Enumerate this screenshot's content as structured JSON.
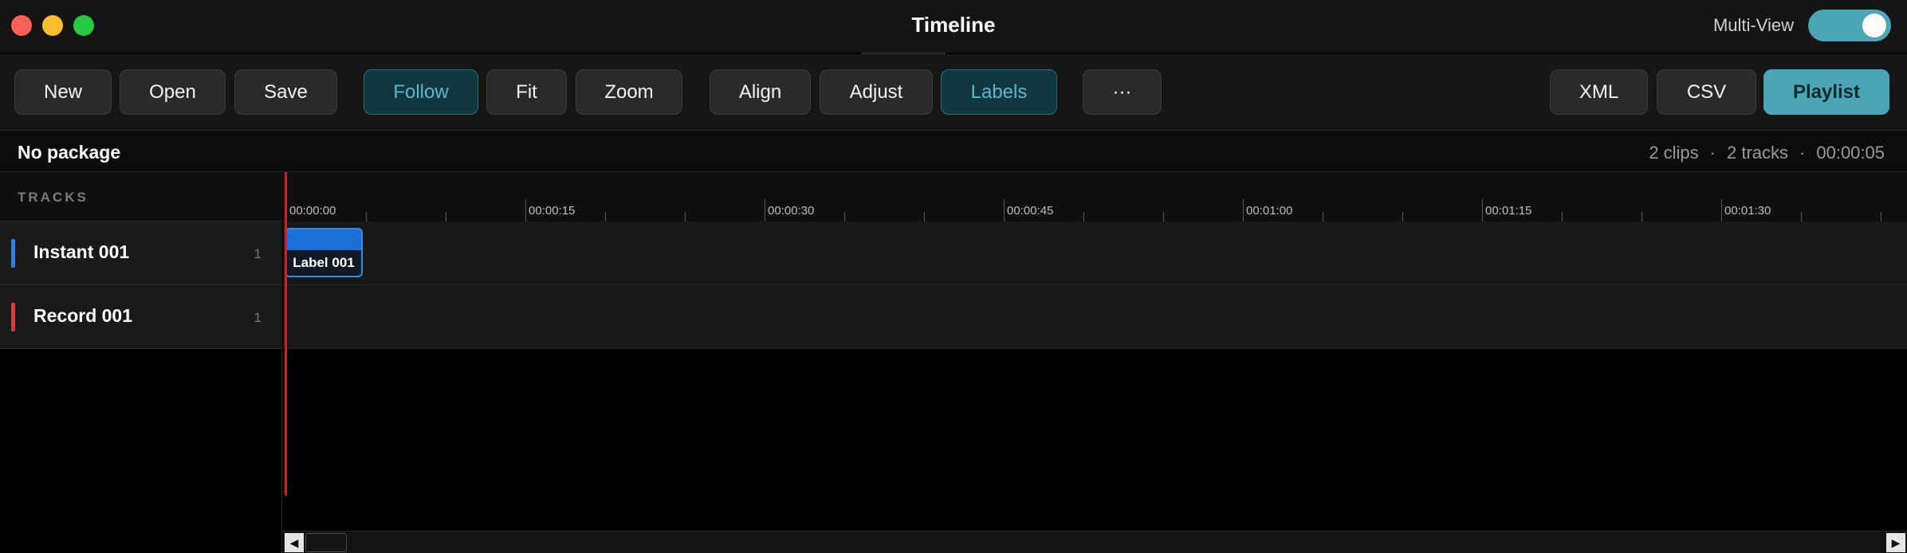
{
  "window": {
    "title": "Timeline",
    "multi_view_label": "Multi-View",
    "multi_view_on": true
  },
  "toolbar": {
    "new_label": "New",
    "open_label": "Open",
    "save_label": "Save",
    "follow_label": "Follow",
    "fit_label": "Fit",
    "zoom_label": "Zoom",
    "align_label": "Align",
    "adjust_label": "Adjust",
    "labels_label": "Labels",
    "more_label": "···",
    "xml_label": "XML",
    "csv_label": "CSV",
    "playlist_label": "Playlist"
  },
  "info": {
    "package": "No package",
    "clips": "2 clips",
    "tracks": "2 tracks",
    "duration": "00:00:05",
    "separator": "·"
  },
  "sidebar": {
    "header": "TRACKS",
    "tracks": [
      {
        "name": "Instant 001",
        "count": "1",
        "color": "#2f7fe0"
      },
      {
        "name": "Record 001",
        "count": "1",
        "color": "#d93a3a"
      }
    ]
  },
  "timeline": {
    "ruler_labels": [
      "00:00:00",
      "00:00:15",
      "00:00:30",
      "00:00:45",
      "00:01:00",
      "00:01:15",
      "00:01:30"
    ],
    "clip_label": "Label 001",
    "scroll_left": "◀",
    "scroll_right": "▶"
  },
  "colors": {
    "accent": "#4aa6b6",
    "playhead": "#e01a1a",
    "clip": "#1c6fd4"
  }
}
